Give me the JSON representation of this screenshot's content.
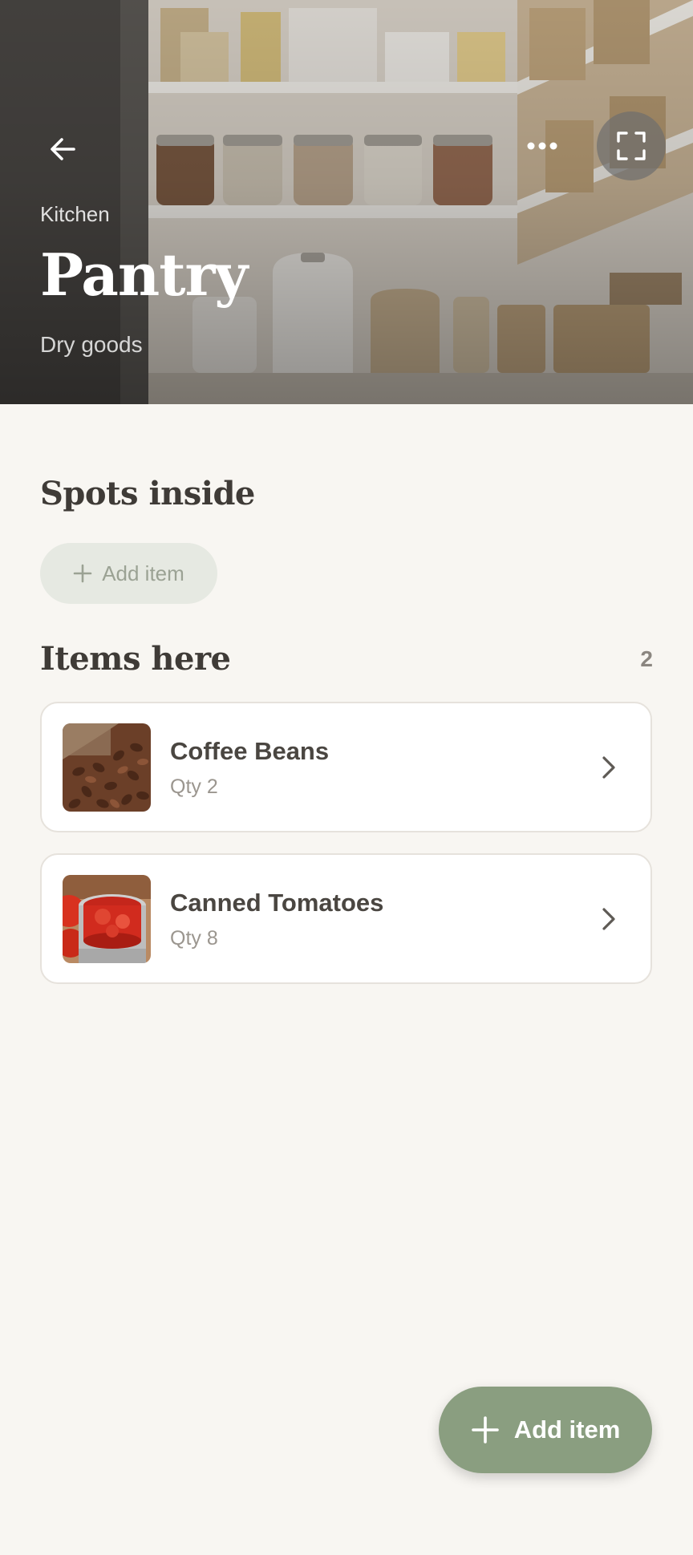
{
  "hero": {
    "context": "Kitchen",
    "title": "Pantry",
    "subtitle": "Dry goods"
  },
  "spots": {
    "title": "Spots inside",
    "add_label": "Add item"
  },
  "items": {
    "title": "Items here",
    "count": "2",
    "list": [
      {
        "name": "Coffee Beans",
        "qty": "Qty 2",
        "thumb": "coffee-beans-photo"
      },
      {
        "name": "Canned Tomatoes",
        "qty": "Qty 8",
        "thumb": "canned-tomatoes-photo"
      }
    ]
  },
  "fab": {
    "label": "Add item"
  },
  "icons": {
    "back": "arrow-left-icon",
    "more": "more-horizontal-icon",
    "expand": "expand-icon",
    "plus": "plus-icon",
    "chevron": "chevron-right-icon"
  },
  "colors": {
    "background": "#f8f6f2",
    "accent": "#8a9e80",
    "chip_bg": "#e6e9e2",
    "heading": "#3f3b37",
    "muted": "#9b968f"
  }
}
